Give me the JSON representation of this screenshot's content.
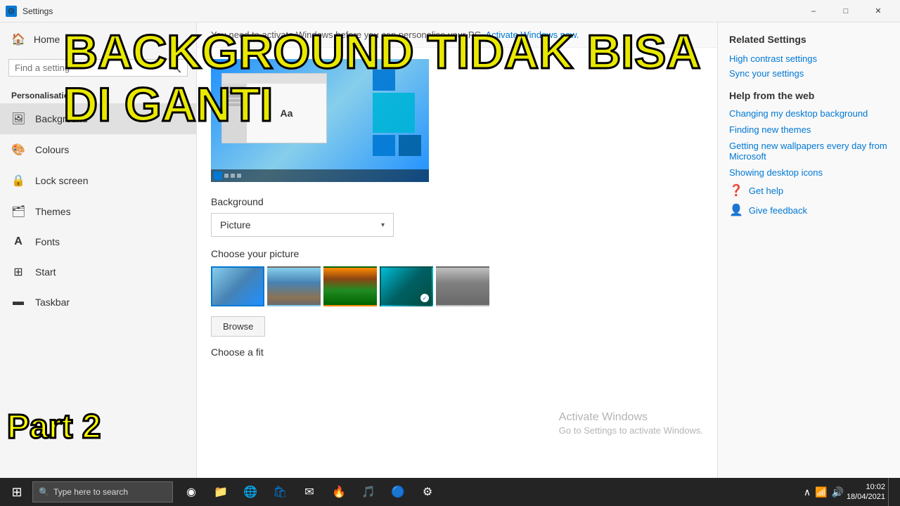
{
  "titlebar": {
    "title": "Settings",
    "minimize": "–",
    "maximize": "□",
    "close": "✕"
  },
  "sidebar": {
    "home_label": "Home",
    "search_placeholder": "Find a setting",
    "section_label": "Personalisation",
    "items": [
      {
        "id": "background",
        "label": "Background",
        "icon": "🖼"
      },
      {
        "id": "colours",
        "label": "Colours",
        "icon": "🎨"
      },
      {
        "id": "lockscreen",
        "label": "Lock screen",
        "icon": "🔒"
      },
      {
        "id": "themes",
        "label": "Themes",
        "icon": "🗂"
      },
      {
        "id": "fonts",
        "label": "Fonts",
        "icon": "A"
      },
      {
        "id": "start",
        "label": "Start",
        "icon": "⊞"
      },
      {
        "id": "taskbar",
        "label": "Taskbar",
        "icon": "▬"
      }
    ]
  },
  "content": {
    "activate_banner": "You need to activate Windows before you can personalise your PC.",
    "activate_link": "Activate Windows now.",
    "background_label": "Background",
    "dropdown_value": "Picture",
    "choose_picture": "Choose your picture",
    "browse_btn": "Browse",
    "choose_fit": "Choose a fit"
  },
  "right_panel": {
    "related_title": "Related Settings",
    "related_links": [
      "High contrast settings",
      "Sync your settings"
    ],
    "help_title": "Help from the web",
    "help_links": [
      "Changing my desktop background",
      "Finding new themes",
      "Getting new wallpapers every day from Microsoft",
      "Showing desktop icons"
    ],
    "actions": [
      {
        "icon": "❓",
        "label": "Get help"
      },
      {
        "icon": "👤",
        "label": "Give feedback"
      }
    ]
  },
  "overlay": {
    "big_text_line1": "BACKGROUND TIDAK BISA",
    "big_text_line2": "DI GANTI",
    "part_label": "Part 2"
  },
  "activate_watermark": {
    "title": "Activate Windows",
    "subtitle": "Go to Settings to activate Windows."
  },
  "taskbar": {
    "search_placeholder": "Type here to search",
    "time": "10:02",
    "date": "18/04/2021"
  }
}
